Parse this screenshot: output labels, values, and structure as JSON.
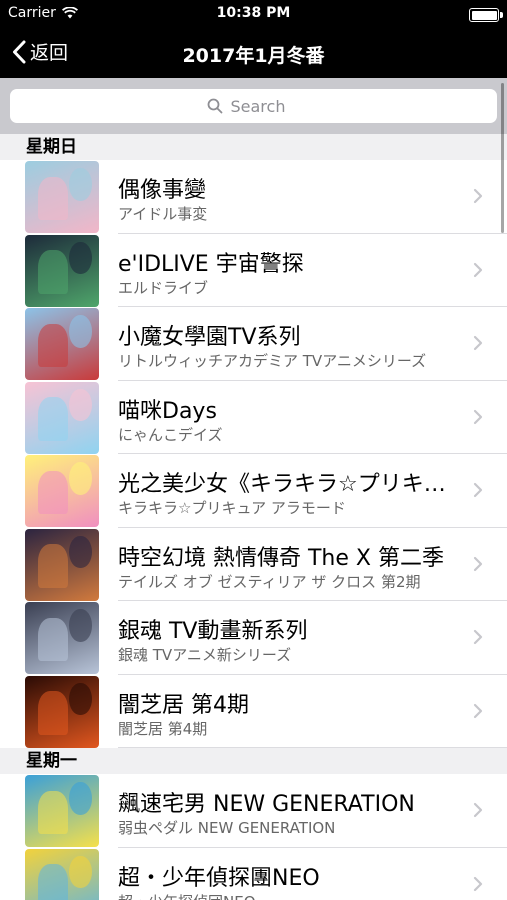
{
  "status_bar": {
    "carrier": "Carrier",
    "time": "10:38 PM",
    "battery_level": 1.0
  },
  "nav": {
    "back_label": "返回",
    "title": "2017年1月冬番"
  },
  "search": {
    "placeholder": "Search"
  },
  "colors": {
    "nav_background": "#000000",
    "search_bar_background": "#c9c9ce",
    "section_header_background": "#f0f0f2",
    "subtitle_text": "#666666",
    "chevron": "#c7c7cc"
  },
  "sections": [
    {
      "header": "星期日",
      "items": [
        {
          "title": "偶像事變",
          "subtitle": "アイドル事変",
          "thumb_colors": [
            "#9ccde0",
            "#f2b6c8"
          ]
        },
        {
          "title": "e'IDLIVE 宇宙警探",
          "subtitle": "エルドライブ",
          "thumb_colors": [
            "#1d2a3a",
            "#4fa66b"
          ]
        },
        {
          "title": "小魔女學園TV系列",
          "subtitle": "リトルウィッチアカデミア TVアニメシリーズ",
          "thumb_colors": [
            "#8cc3e8",
            "#c93a3a"
          ]
        },
        {
          "title": "喵咪Days",
          "subtitle": "にゃんこデイズ",
          "thumb_colors": [
            "#f7c3d4",
            "#8fd3f0"
          ]
        },
        {
          "title": "光之美少女《キラキラ☆プリキュア アラモード》",
          "subtitle": "キラキラ☆プリキュア アラモード",
          "thumb_colors": [
            "#fff17a",
            "#f08fc0"
          ]
        },
        {
          "title": "時空幻境 熱情傳奇 The X 第二季",
          "subtitle": "テイルズ オブ ゼスティリア ザ クロス 第2期",
          "thumb_colors": [
            "#2b2440",
            "#d27a3d"
          ]
        },
        {
          "title": "銀魂 TV動畫新系列",
          "subtitle": "銀魂 TVアニメ新シリーズ",
          "thumb_colors": [
            "#3a3f52",
            "#b8c4d8"
          ]
        },
        {
          "title": "闇芝居 第4期",
          "subtitle": "闇芝居 第4期",
          "thumb_colors": [
            "#2a0b05",
            "#e2571f"
          ]
        }
      ]
    },
    {
      "header": "星期一",
      "items": [
        {
          "title": "飆速宅男 NEW GENERATION",
          "subtitle": "弱虫ペダル NEW GENERATION",
          "thumb_colors": [
            "#3ba0d8",
            "#f6e04a"
          ]
        },
        {
          "title": "超・少年偵探團NEO",
          "subtitle": "超・少年探偵団NEO",
          "thumb_colors": [
            "#f2d23c",
            "#5fb4e0"
          ]
        }
      ]
    }
  ]
}
